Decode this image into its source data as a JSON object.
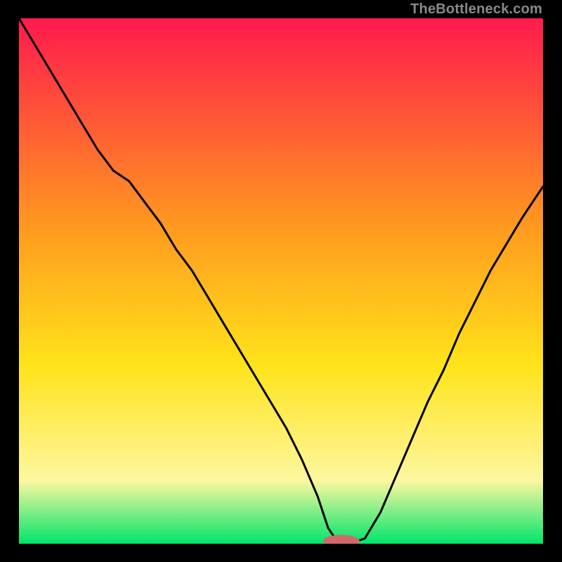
{
  "watermark": "TheBottleneck.com",
  "colors": {
    "frame": "#000000",
    "grad_top": "#ff1a4d",
    "grad_mid1": "#ff9a1f",
    "grad_mid2": "#ffe31a",
    "grad_low": "#fdf7a0",
    "grad_bottom": "#00e56b",
    "curve": "#000000",
    "marker": "#cf6a6a"
  },
  "chart_data": {
    "type": "line",
    "title": "",
    "xlabel": "",
    "ylabel": "",
    "xlim": [
      0,
      100
    ],
    "ylim": [
      0,
      100
    ],
    "x": [
      0,
      3,
      6,
      9,
      12,
      15,
      18,
      21,
      24,
      27,
      30,
      33,
      36,
      39,
      42,
      45,
      48,
      51,
      54,
      57,
      59,
      61,
      63,
      66,
      69,
      72,
      75,
      78,
      81,
      84,
      87,
      90,
      93,
      96,
      100
    ],
    "values": [
      100,
      95,
      90,
      85,
      80,
      75,
      71,
      69,
      65,
      61,
      56,
      52,
      47,
      42,
      37,
      32,
      27,
      22,
      16,
      9,
      3,
      0,
      0,
      1,
      6,
      13,
      20,
      27,
      33,
      40,
      46,
      52,
      57,
      62,
      68
    ],
    "marker": {
      "x": 61.5,
      "y": 0.5,
      "rx": 3.5,
      "ry": 1.2
    }
  }
}
